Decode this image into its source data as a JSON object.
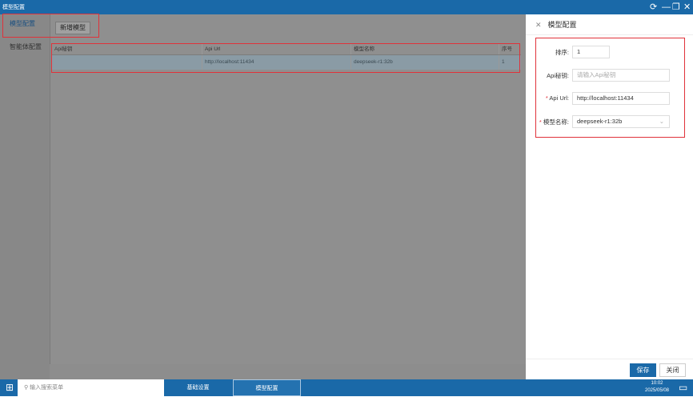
{
  "window": {
    "title": "模型配置",
    "controls": [
      "refresh",
      "minimize",
      "restore",
      "close"
    ]
  },
  "sidebar": {
    "items": [
      {
        "label": "模型配置",
        "active": true
      },
      {
        "label": "智能体配置"
      }
    ]
  },
  "toolbar": {
    "add_label": "新增模型"
  },
  "table": {
    "columns": [
      "Api秘钥",
      "Api Url",
      "模型名称",
      "序号"
    ],
    "rows": [
      [
        "",
        "http://localhost:11434",
        "deepseek-r1:32b",
        "1"
      ]
    ]
  },
  "panel": {
    "title": "模型配置",
    "fields": {
      "order": {
        "label": "排序:",
        "value": "1"
      },
      "api_key": {
        "label": "Api秘钥:",
        "placeholder": "请输入Api秘钥"
      },
      "api_url": {
        "label": "Api Url:",
        "value": "http://localhost:11434",
        "required": true
      },
      "model_name": {
        "label": "模型名称:",
        "value": "deepseek-r1:32b",
        "required": true
      }
    },
    "save_label": "保存",
    "close_label": "关闭"
  },
  "taskbar": {
    "search_placeholder": "输入搜索菜单",
    "items": [
      "基础设置",
      "模型配置"
    ],
    "time": "10:02",
    "date": "2025/05/08"
  },
  "colors": {
    "accent": "#1a69a8",
    "highlight": "#e0323a"
  }
}
